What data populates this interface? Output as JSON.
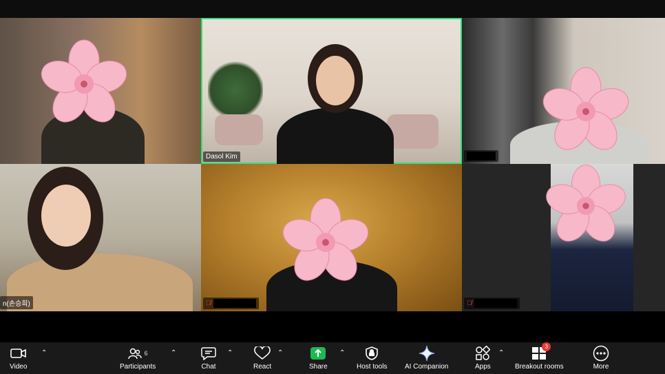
{
  "tiles": [
    {
      "name": "",
      "muted": false
    },
    {
      "name": "Dasol Kim",
      "muted": false
    },
    {
      "name": "",
      "muted": false
    },
    {
      "name": "n(손승희)",
      "muted": false
    },
    {
      "name": "",
      "muted": true
    },
    {
      "name": "",
      "muted": true
    }
  ],
  "toolbar": {
    "video": {
      "label": "Video",
      "icon": "video-camera-icon"
    },
    "participants": {
      "label": "Participants",
      "count": "6",
      "icon": "participants-icon"
    },
    "chat": {
      "label": "Chat",
      "icon": "chat-icon"
    },
    "react": {
      "label": "React",
      "icon": "heart-icon"
    },
    "share": {
      "label": "Share",
      "icon": "share-arrow-icon"
    },
    "host_tools": {
      "label": "Host tools",
      "icon": "shield-icon"
    },
    "ai_companion": {
      "label": "AI Companion",
      "icon": "sparkle-icon"
    },
    "apps": {
      "label": "Apps",
      "icon": "apps-icon"
    },
    "breakout_rooms": {
      "label": "Breakout rooms",
      "badge": "3",
      "icon": "breakout-grid-icon"
    },
    "more": {
      "label": "More",
      "icon": "more-dots-icon"
    }
  },
  "colors": {
    "active_speaker_border": "#2fe07a",
    "share_green": "#1db954",
    "badge_red": "#e53935",
    "flower_pink": "#f6b6c8"
  }
}
